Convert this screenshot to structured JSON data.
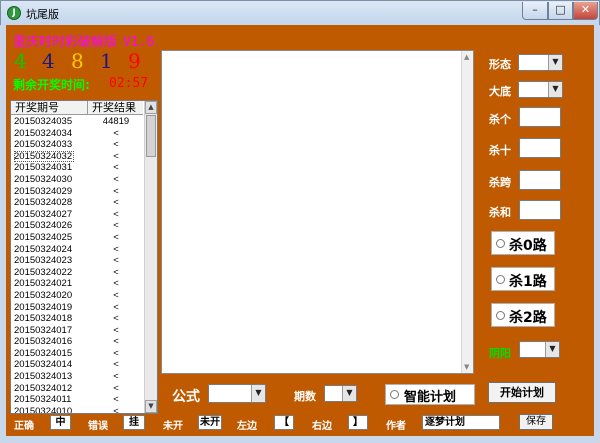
{
  "window": {
    "title": "坑尾版",
    "app_icon_glyph": "J",
    "min_glyph": "–",
    "max_glyph": "□",
    "close_glyph": "✕"
  },
  "brand": {
    "name": "重庆时时彩破解版",
    "version": "V1.6",
    "color": "#ff00ff"
  },
  "digits": [
    {
      "value": "4",
      "color": "#00cc00"
    },
    {
      "value": "4",
      "color": "#1a1a80"
    },
    {
      "value": "8",
      "color": "#ffcc00"
    },
    {
      "value": "1",
      "color": "#1a1a80"
    },
    {
      "value": "9",
      "color": "#ff0000"
    }
  ],
  "countdown": {
    "label": "剩余开奖时间:",
    "value": "02:57"
  },
  "list": {
    "headers": [
      "开奖期号",
      "开奖结果"
    ],
    "rows": [
      [
        "20150324035",
        "44819"
      ],
      [
        "20150324034",
        "<"
      ],
      [
        "20150324033",
        "<"
      ],
      [
        "20150324032",
        "<"
      ],
      [
        "20150324031",
        "<"
      ],
      [
        "20150324030",
        "<"
      ],
      [
        "20150324029",
        "<"
      ],
      [
        "20150324028",
        "<"
      ],
      [
        "20150324027",
        "<"
      ],
      [
        "20150324026",
        "<"
      ],
      [
        "20150324025",
        "<"
      ],
      [
        "20150324024",
        "<"
      ],
      [
        "20150324023",
        "<"
      ],
      [
        "20150324022",
        "<"
      ],
      [
        "20150324021",
        "<"
      ],
      [
        "20150324020",
        "<"
      ],
      [
        "20150324019",
        "<"
      ],
      [
        "20150324018",
        "<"
      ],
      [
        "20150324017",
        "<"
      ],
      [
        "20150324016",
        "<"
      ],
      [
        "20150324015",
        "<"
      ],
      [
        "20150324014",
        "<"
      ],
      [
        "20150324013",
        "<"
      ],
      [
        "20150324012",
        "<"
      ],
      [
        "20150324011",
        "<"
      ],
      [
        "20150324010",
        "<"
      ]
    ],
    "scroll_up": "▲",
    "scroll_down": "▼"
  },
  "side": {
    "xingtai": "形态",
    "dadi": "大底",
    "shage": "杀个",
    "shashi": "杀十",
    "shakua": "杀跨",
    "shahe": "杀和",
    "kill0": "杀0路",
    "kill1": "杀1路",
    "kill2": "杀2路",
    "yinyang": "阴阳",
    "dropdown_glyph": "▼"
  },
  "bottom": {
    "formula": "公式",
    "periods": "期数",
    "smart_plan": "智能计划",
    "start_plan": "开始计划",
    "correct_label": "正确",
    "correct_value": "中",
    "wrong_label": "错误",
    "wrong_value": "挂",
    "notopen_label": "未开",
    "notopen_value": "未开",
    "left_label": "左边",
    "left_value": "【",
    "right_label": "右边",
    "right_value": "】",
    "author_label": "作者",
    "author_value": "逐梦计划",
    "save": "保存"
  },
  "colors": {
    "background": "#c05a00",
    "label": "#ffffff",
    "countdown_label": "#00ff00",
    "countdown_value": "#ff0000",
    "yinyang": "#00dd00"
  }
}
